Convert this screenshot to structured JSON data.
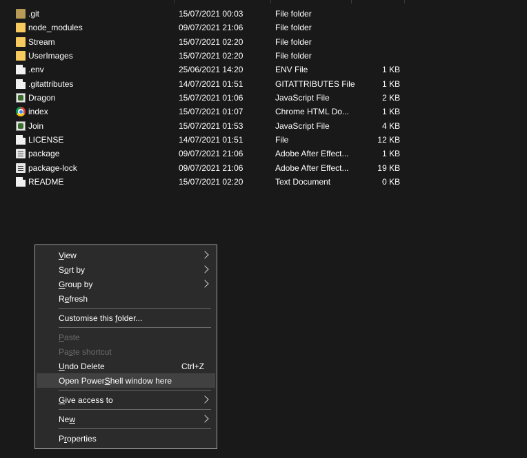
{
  "files": [
    {
      "name": ".git",
      "date": "15/07/2021 00:03",
      "type": "File folder",
      "size": "",
      "icon": "folder-git-icon"
    },
    {
      "name": "node_modules",
      "date": "09/07/2021 21:06",
      "type": "File folder",
      "size": "",
      "icon": "folder-icon"
    },
    {
      "name": "Stream",
      "date": "15/07/2021 02:20",
      "type": "File folder",
      "size": "",
      "icon": "folder-icon"
    },
    {
      "name": "UserImages",
      "date": "15/07/2021 02:20",
      "type": "File folder",
      "size": "",
      "icon": "folder-icon"
    },
    {
      "name": ".env",
      "date": "25/06/2021 14:20",
      "type": "ENV File",
      "size": "1 KB",
      "icon": "file-icon"
    },
    {
      "name": ".gitattributes",
      "date": "14/07/2021 01:51",
      "type": "GITATTRIBUTES File",
      "size": "1 KB",
      "icon": "file-icon"
    },
    {
      "name": "Dragon",
      "date": "15/07/2021 01:06",
      "type": "JavaScript File",
      "size": "2 KB",
      "icon": "javascript-file-icon"
    },
    {
      "name": "index",
      "date": "15/07/2021 01:07",
      "type": "Chrome HTML Do...",
      "size": "1 KB",
      "icon": "chrome-icon"
    },
    {
      "name": "Join",
      "date": "15/07/2021 01:53",
      "type": "JavaScript File",
      "size": "4 KB",
      "icon": "javascript-file-icon"
    },
    {
      "name": "LICENSE",
      "date": "14/07/2021 01:51",
      "type": "File",
      "size": "12 KB",
      "icon": "file-icon"
    },
    {
      "name": "package",
      "date": "09/07/2021 21:06",
      "type": "Adobe After Effect...",
      "size": "1 KB",
      "icon": "after-effects-file-icon"
    },
    {
      "name": "package-lock",
      "date": "09/07/2021 21:06",
      "type": "Adobe After Effect...",
      "size": "19 KB",
      "icon": "after-effects-file-icon"
    },
    {
      "name": "README",
      "date": "15/07/2021 02:20",
      "type": "Text Document",
      "size": "0 KB",
      "icon": "text-document-icon"
    }
  ],
  "context_menu": {
    "items": [
      {
        "id": "view",
        "label": "View",
        "mnemonic": "V",
        "submenu": true
      },
      {
        "id": "sort-by",
        "label": "Sort by",
        "mnemonic": "o",
        "submenu": true
      },
      {
        "id": "group-by",
        "label": "Group by",
        "mnemonic": "G",
        "submenu": true
      },
      {
        "id": "refresh",
        "label": "Refresh",
        "mnemonic": "e"
      },
      {
        "separator": true
      },
      {
        "id": "customise-folder",
        "label": "Customise this folder...",
        "mnemonic": "f"
      },
      {
        "separator": true
      },
      {
        "id": "paste",
        "label": "Paste",
        "mnemonic": "P",
        "disabled": true
      },
      {
        "id": "paste-shortcut",
        "label": "Paste shortcut",
        "mnemonic": "s",
        "disabled": true
      },
      {
        "id": "undo-delete",
        "label": "Undo Delete",
        "mnemonic": "U",
        "shortcut": "Ctrl+Z"
      },
      {
        "id": "open-powershell",
        "label": "Open PowerShell window here",
        "mnemonic": "S",
        "highlighted": true
      },
      {
        "separator": true
      },
      {
        "id": "give-access",
        "label": "Give access to",
        "mnemonic": "G",
        "submenu": true
      },
      {
        "separator": true
      },
      {
        "id": "new",
        "label": "New",
        "mnemonic": "w",
        "submenu": true
      },
      {
        "separator": true
      },
      {
        "id": "properties",
        "label": "Properties",
        "mnemonic": "r"
      }
    ]
  },
  "colors": {
    "background": "#191919",
    "menu_background": "#2b2b2b",
    "menu_border": "#a0a0a0",
    "menu_highlight": "#414141",
    "disabled_text": "#6d6d6d",
    "folder": "#f6ca5f"
  }
}
